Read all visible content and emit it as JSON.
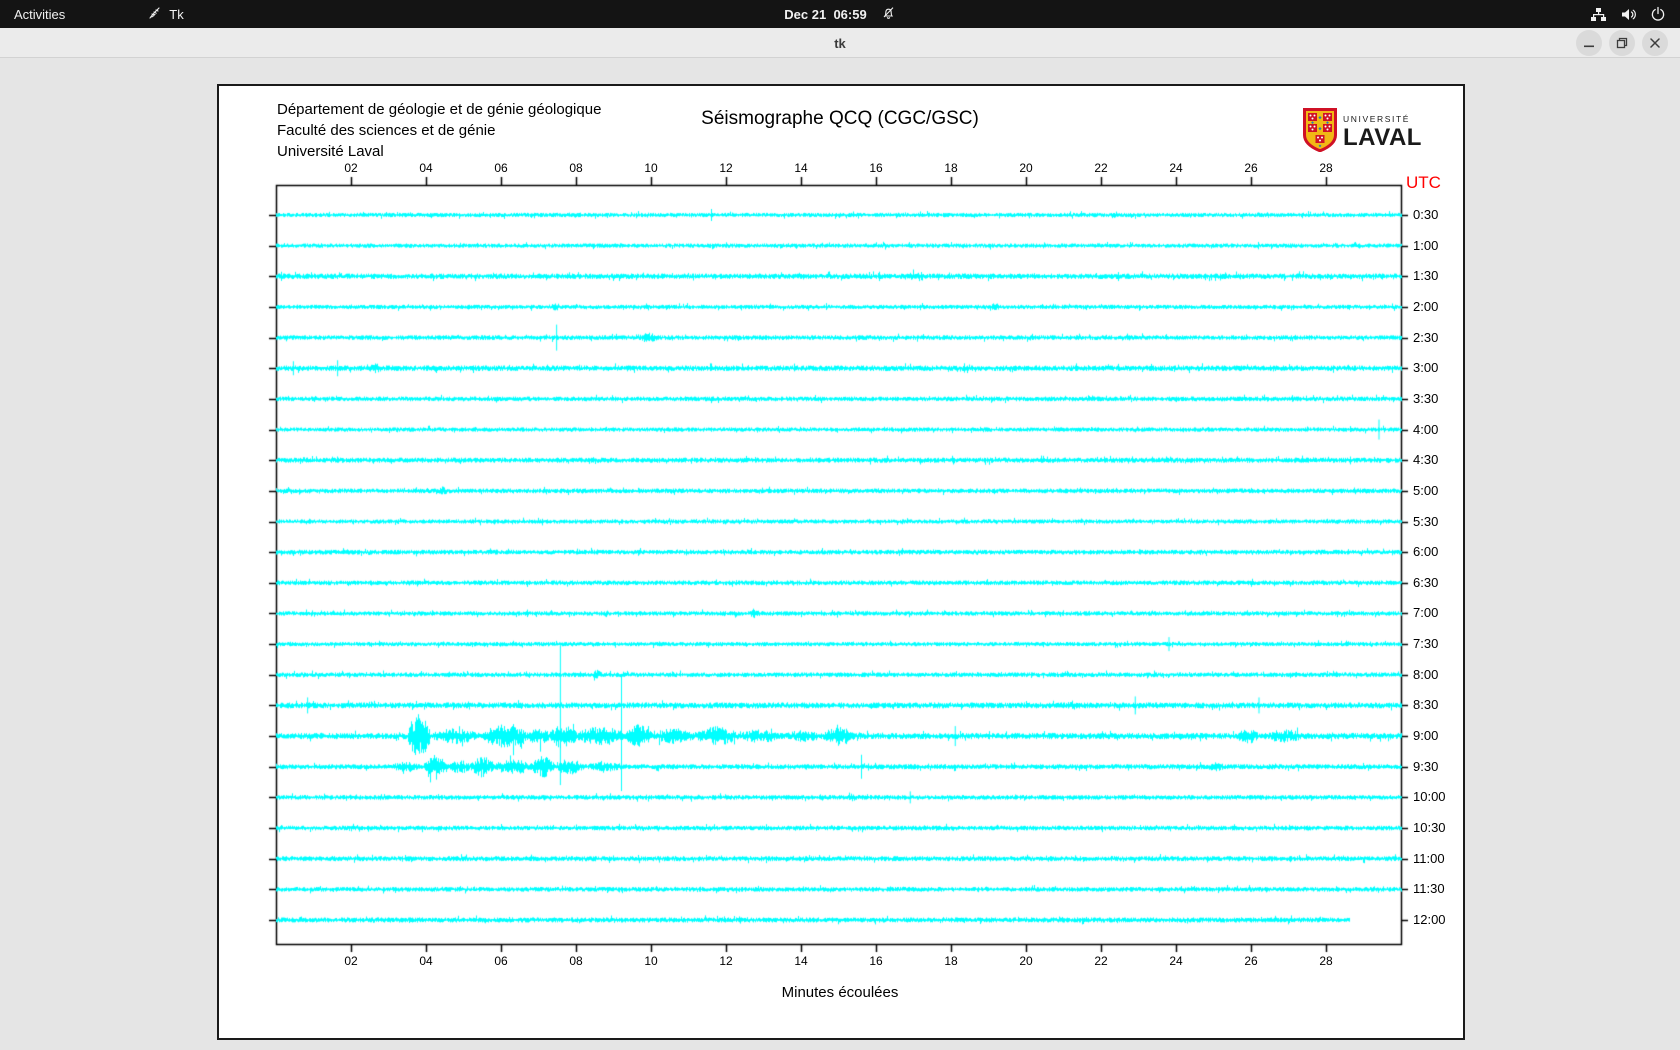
{
  "topbar": {
    "activities": "Activities",
    "app_name": "Tk",
    "clock": "Dec 21  06:59"
  },
  "titlebar": {
    "title": "tk"
  },
  "document": {
    "org_lines": [
      "Département de géologie et de génie géologique",
      "Faculté des sciences et de génie",
      "Université Laval"
    ],
    "title": "Séismographe QCQ (CGC/GSC)",
    "utc_label": "UTC",
    "xlabel": "Minutes écoulées",
    "logo": {
      "small": "UNIVERSITÉ",
      "large": "LAVAL"
    }
  },
  "chart_data": {
    "type": "line",
    "subtype": "helicorder-seismogram",
    "title": "Séismographe QCQ (CGC/GSC)",
    "xlabel": "Minutes écoulées",
    "ylabel": "UTC",
    "x_range_minutes": [
      0,
      30
    ],
    "x_ticks": [
      "02",
      "04",
      "06",
      "08",
      "10",
      "12",
      "14",
      "16",
      "18",
      "20",
      "22",
      "24",
      "26",
      "28"
    ],
    "trace_color": "#00ffff",
    "axis_color": "#000000",
    "rows": [
      {
        "time": "0:30",
        "base": 2.2,
        "end": 30,
        "spikes": [
          [
            11.6,
            6,
            6
          ]
        ],
        "bursts": []
      },
      {
        "time": "1:00",
        "base": 2.2,
        "end": 30,
        "spikes": [],
        "bursts": []
      },
      {
        "time": "1:30",
        "base": 2.8,
        "end": 30,
        "spikes": [],
        "bursts": [
          [
            16.8,
            17.4,
            5
          ]
        ]
      },
      {
        "time": "2:00",
        "base": 2.2,
        "end": 30,
        "spikes": [],
        "bursts": [
          [
            7.3,
            7.6,
            4
          ],
          [
            19.0,
            19.3,
            4
          ]
        ]
      },
      {
        "time": "2:30",
        "base": 2.4,
        "end": 30,
        "spikes": [
          [
            7.47,
            13,
            13
          ]
        ],
        "bursts": [
          [
            9.6,
            10.2,
            5
          ]
        ]
      },
      {
        "time": "3:00",
        "base": 2.8,
        "end": 30,
        "spikes": [
          [
            0.45,
            7,
            7
          ],
          [
            1.63,
            8,
            8
          ]
        ],
        "bursts": [
          [
            2.4,
            2.9,
            5
          ]
        ]
      },
      {
        "time": "3:30",
        "base": 2.4,
        "end": 30,
        "spikes": [],
        "bursts": []
      },
      {
        "time": "4:00",
        "base": 2.2,
        "end": 30,
        "spikes": [
          [
            29.4,
            10,
            10
          ]
        ],
        "bursts": []
      },
      {
        "time": "4:30",
        "base": 2.6,
        "end": 30,
        "spikes": [],
        "bursts": [
          [
            0.5,
            0.9,
            4
          ]
        ]
      },
      {
        "time": "5:00",
        "base": 2.4,
        "end": 30,
        "spikes": [],
        "bursts": [
          [
            4.3,
            4.6,
            5
          ]
        ]
      },
      {
        "time": "5:30",
        "base": 2.2,
        "end": 30,
        "spikes": [],
        "bursts": []
      },
      {
        "time": "6:00",
        "base": 2.4,
        "end": 30,
        "spikes": [],
        "bursts": []
      },
      {
        "time": "6:30",
        "base": 2.4,
        "end": 30,
        "spikes": [],
        "bursts": []
      },
      {
        "time": "7:00",
        "base": 2.3,
        "end": 30,
        "spikes": [],
        "bursts": [
          [
            12.6,
            12.9,
            5
          ]
        ]
      },
      {
        "time": "7:30",
        "base": 2.2,
        "end": 30,
        "spikes": [
          [
            23.8,
            7,
            7
          ]
        ],
        "bursts": []
      },
      {
        "time": "8:00",
        "base": 2.4,
        "end": 30,
        "spikes": [],
        "bursts": [
          [
            8.4,
            8.7,
            5
          ]
        ]
      },
      {
        "time": "8:30",
        "base": 3.0,
        "end": 30,
        "spikes": [
          [
            0.83,
            8,
            8
          ],
          [
            22.9,
            9,
            9
          ],
          [
            26.2,
            8,
            8
          ]
        ],
        "bursts": [
          [
            21.0,
            21.4,
            5
          ]
        ]
      },
      {
        "time": "9:00",
        "base": 3.2,
        "end": 30,
        "spikes": [
          [
            7.57,
            91,
            49
          ],
          [
            9.2,
            61,
            55
          ],
          [
            18.1,
            10,
            10
          ]
        ],
        "bursts": [
          [
            3.5,
            4.1,
            22
          ],
          [
            4.1,
            5.5,
            8
          ],
          [
            5.5,
            6.7,
            12
          ],
          [
            6.7,
            7.3,
            9
          ],
          [
            7.3,
            8.0,
            13
          ],
          [
            8.0,
            9.3,
            10
          ],
          [
            9.3,
            10.0,
            12
          ],
          [
            10.0,
            11.2,
            8
          ],
          [
            11.2,
            12.3,
            10
          ],
          [
            12.3,
            13.5,
            7
          ],
          [
            13.5,
            14.6,
            6
          ],
          [
            14.6,
            15.4,
            10
          ],
          [
            25.6,
            26.2,
            8
          ],
          [
            26.4,
            27.4,
            7
          ]
        ]
      },
      {
        "time": "9:30",
        "base": 2.6,
        "end": 30,
        "spikes": [
          [
            15.6,
            12,
            12
          ]
        ],
        "bursts": [
          [
            3.0,
            3.9,
            5
          ],
          [
            3.9,
            4.6,
            10
          ],
          [
            4.6,
            5.2,
            7
          ],
          [
            5.2,
            5.8,
            11
          ],
          [
            5.8,
            6.8,
            8
          ],
          [
            6.8,
            7.4,
            11
          ],
          [
            7.4,
            8.2,
            8
          ],
          [
            8.2,
            9.3,
            5
          ],
          [
            24.8,
            25.3,
            5
          ]
        ]
      },
      {
        "time": "10:00",
        "base": 2.4,
        "end": 30,
        "spikes": [
          [
            16.9,
            6,
            6
          ]
        ],
        "bursts": [
          [
            15.2,
            15.5,
            4
          ]
        ]
      },
      {
        "time": "10:30",
        "base": 2.4,
        "end": 30,
        "spikes": [],
        "bursts": []
      },
      {
        "time": "11:00",
        "base": 2.6,
        "end": 30,
        "spikes": [],
        "bursts": []
      },
      {
        "time": "11:30",
        "base": 2.4,
        "end": 30,
        "spikes": [],
        "bursts": []
      },
      {
        "time": "12:00",
        "base": 2.6,
        "end": 28.6,
        "spikes": [],
        "bursts": []
      }
    ]
  }
}
